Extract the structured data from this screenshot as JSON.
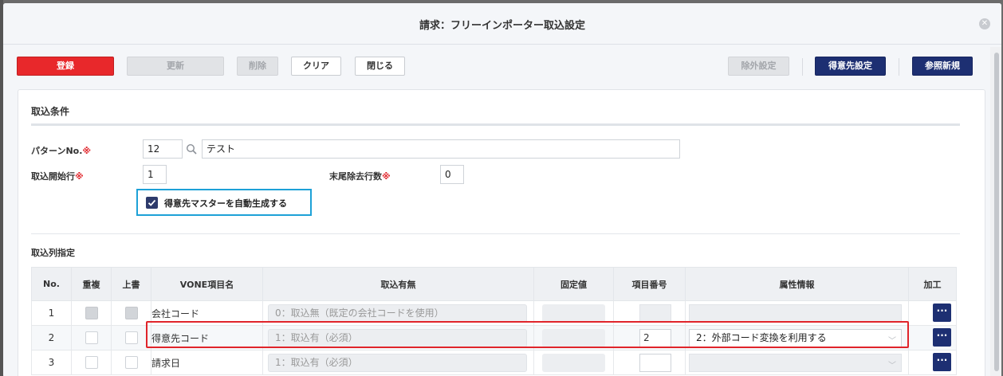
{
  "dialog": {
    "title": "請求：フリーインポーター取込設定"
  },
  "toolbar": {
    "register": "登録",
    "update": "更新",
    "delete": "削除",
    "clear": "クリア",
    "close": "閉じる",
    "exclusion_settings": "除外設定",
    "customer_settings": "得意先設定",
    "reference_new": "参照新規"
  },
  "import_conditions": {
    "section_title": "取込条件",
    "pattern_label": "パターンNo.",
    "required_mark": "※",
    "pattern_no": "12",
    "pattern_name": "テスト",
    "start_row_label": "取込開始行",
    "start_row": "1",
    "trailing_rows_label": "末尾除去行数",
    "trailing_rows": "0",
    "auto_create_customer_label": "得意先マスターを自動生成する",
    "auto_create_customer_checked": true
  },
  "columns_section": {
    "section_title": "取込列指定",
    "headers": [
      "No.",
      "重複",
      "上書",
      "VONE項目名",
      "取込有無",
      "固定値",
      "項目番号",
      "属性情報",
      "加工"
    ],
    "rows": [
      {
        "no": "1",
        "vone_name": "会社コード",
        "import_flag": "0：取込無（既定の会社コードを使用）",
        "item_no": "",
        "attribute": ""
      },
      {
        "no": "2",
        "vone_name": "得意先コード",
        "import_flag": "1：取込有（必須）",
        "item_no": "2",
        "attribute": "2：外部コード変換を利用する"
      },
      {
        "no": "3",
        "vone_name": "請求日",
        "import_flag": "1：取込有（必須）",
        "item_no": "",
        "attribute": ""
      }
    ],
    "process_button": "···"
  },
  "icons": {
    "close": "close-icon",
    "search": "search-icon",
    "check": "check-icon",
    "chevron": "chevron-down-icon"
  },
  "colors": {
    "primary_red": "#e8282b",
    "navy": "#1d2f72",
    "highlight_blue": "#1da1d7",
    "highlight_red": "#e0242a"
  }
}
